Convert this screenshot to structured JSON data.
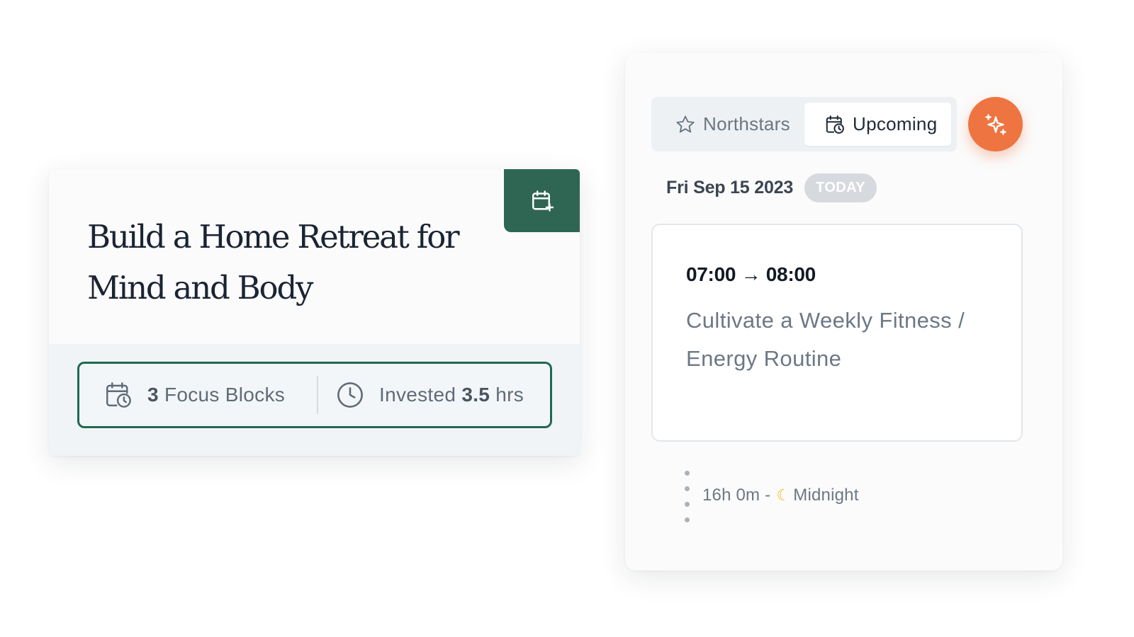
{
  "goal_card": {
    "title": "Build a Home Retreat for Mind and Body",
    "schedule_icon": "calendar-plus-icon",
    "focus_blocks": {
      "count": "3",
      "label": "Focus Blocks",
      "icon": "calendar-clock-icon"
    },
    "invested": {
      "prefix": "Invested",
      "value": "3.5",
      "unit": "hrs",
      "icon": "clock-icon"
    }
  },
  "planner": {
    "tabs": [
      {
        "label": "Northstars",
        "icon": "star-icon",
        "active": false
      },
      {
        "label": "Upcoming",
        "icon": "calendar-clock-icon",
        "active": true
      }
    ],
    "magic_button_icon": "sparkles-icon",
    "date": "Fri Sep 15 2023",
    "today_badge": "TODAY",
    "event": {
      "time": "07:00 → 08:00",
      "title": "Cultivate a Weekly Fitness / Energy Routine"
    },
    "gap": {
      "duration": "16h 0m -",
      "moon_icon": "moon-icon",
      "label": "Midnight"
    }
  },
  "colors": {
    "brand_green": "#2f6653",
    "outline_green": "#1f6a50",
    "accent_orange": "#ee7441",
    "badge_gray": "#d6dade"
  }
}
